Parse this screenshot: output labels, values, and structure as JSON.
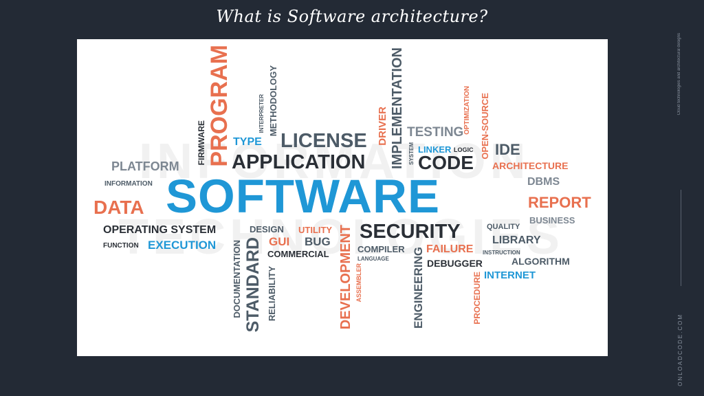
{
  "title": "What is Software architecture?",
  "side": {
    "tagline": "Cloud technologies and architectural designs",
    "brand": "ONLOADCODE.COM"
  },
  "cloud": {
    "background_words": [
      "INFORMATION",
      "TECHNOLOGIES"
    ],
    "words": {
      "software": "SOFTWARE",
      "application": "APPLICATION",
      "license": "LICENSE",
      "type": "TYPE",
      "code": "CODE",
      "testing": "TESTING",
      "linker": "LINKER",
      "logic": "LOGIC",
      "ide": "IDE",
      "architecture": "ARCHITECTURE",
      "dbms": "DBMS",
      "report": "REPORT",
      "business": "BUSINESS",
      "quality": "QUALITY",
      "library": "LIBRARY",
      "instruction": "INSTRUCTION",
      "algorithm": "ALGORITHM",
      "internet": "INTERNET",
      "platform": "PLATFORM",
      "information": "INFORMATION",
      "data": "DATA",
      "operating_system": "OPERATING SYSTEM",
      "design": "DESIGN",
      "function": "FUNCTION",
      "execution": "EXECUTION",
      "utility": "UTILITY",
      "gui": "GUI",
      "bug": "BUG",
      "commercial": "COMMERCIAL",
      "security": "SECURITY",
      "compiler": "COMPILER",
      "language": "LANGUAGE",
      "failure": "FAILURE",
      "debugger": "DEBUGGER",
      "program": "PROGRAM",
      "firmware": "FIRMWARE",
      "interpreter": "INTERPRETER",
      "methodology": "METHODOLOGY",
      "implementation": "IMPLEMENTATION",
      "driver": "DRIVER",
      "system": "SYSTEM",
      "optimization": "OPTIMIZATION",
      "open_source": "OPEN-SOURCE",
      "documentation": "DOCUMENTATION",
      "standard": "STANDARD",
      "reliability": "RELIABILITY",
      "development": "DEVELOPMENT",
      "assembler": "ASSEMBLER",
      "engineering": "ENGINEERING",
      "procedure": "PROCEDURE"
    }
  },
  "colors": {
    "background": "#232a35",
    "orange": "#e8704f",
    "blue": "#1f97d6",
    "dark": "#2a2f36",
    "grey": "#7d8792"
  }
}
